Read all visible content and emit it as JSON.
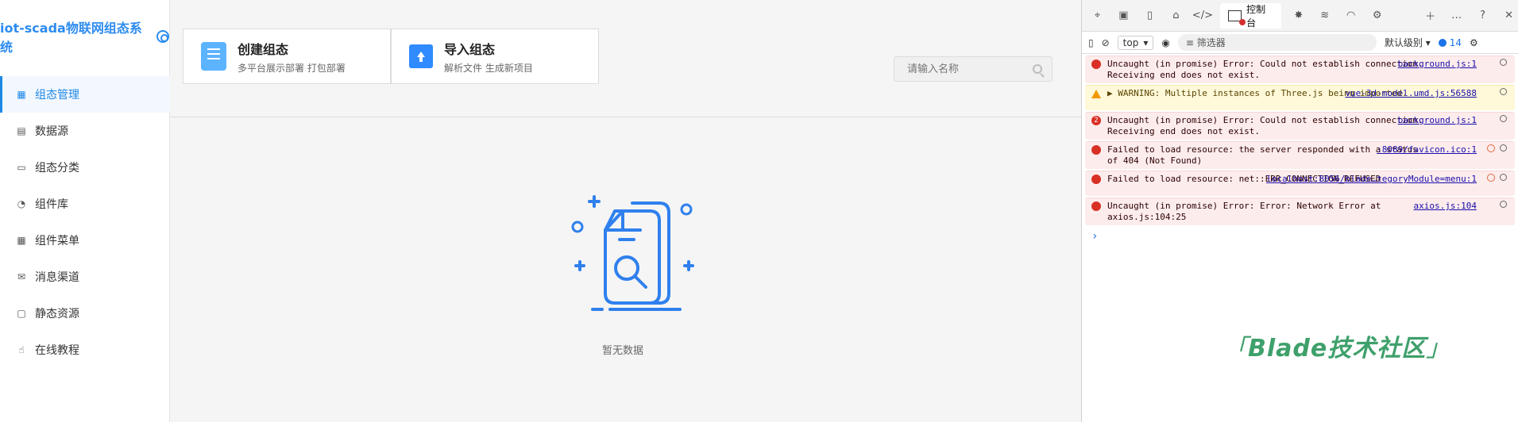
{
  "app": {
    "brand": "iot-scada物联网组态系统",
    "menu": [
      {
        "label": "组态管理",
        "icon": "grid-icon",
        "active": true
      },
      {
        "label": "数据源",
        "icon": "database-icon"
      },
      {
        "label": "组态分类",
        "icon": "folder-icon"
      },
      {
        "label": "组件库",
        "icon": "component-icon"
      },
      {
        "label": "组件菜单",
        "icon": "menu-grid-icon"
      },
      {
        "label": "消息渠道",
        "icon": "mail-icon"
      },
      {
        "label": "静态资源",
        "icon": "archive-icon"
      },
      {
        "label": "在线教程",
        "icon": "hand-icon"
      }
    ],
    "actions": [
      {
        "title": "创建组态",
        "subtitle": "多平台展示部署 打包部署"
      },
      {
        "title": "导入组态",
        "subtitle": "解析文件 生成新项目"
      }
    ],
    "search": {
      "placeholder": "请输入名称"
    },
    "empty": {
      "text": "暂无数据"
    }
  },
  "devtools": {
    "console_tab": "控制台",
    "context": "top",
    "filter_placeholder": "筛选器",
    "level": "默认级别",
    "issue_count": "14",
    "messages": [
      {
        "type": "error",
        "count": "",
        "text": "Uncaught (in promise) Error: Could not establish connection. Receiving end does not exist.",
        "source": "background.js:1"
      },
      {
        "type": "warning",
        "count": "",
        "text": "▶ WARNING: Multiple instances of Three.js being imported.",
        "source": "vue-3d-model.umd.js:56588"
      },
      {
        "type": "error",
        "count": "2",
        "text": "Uncaught (in promise) Error: Could not establish connection. Receiving end does not exist.",
        "source": "background.js:1"
      },
      {
        "type": "error",
        "count": "",
        "text": "Failed to load resource: the server responded with a status of 404 (Not Found)",
        "source": ":8089/favicon.ico:1"
      },
      {
        "type": "error",
        "count": "",
        "text": "Failed to load resource: net::ERR_CONNECTION_REFUSED",
        "source": "localhost:8056/blade…tegoryModule=menu:1"
      },
      {
        "type": "error",
        "count": "",
        "text": "Uncaught (in promise) Error: Error: Network Error at axios.js:104:25",
        "source": "axios.js:104"
      }
    ],
    "prompt": "›"
  },
  "watermark": "Blade技术社区",
  "colors": {
    "accent": "#2d8cf0",
    "error_bg": "#fdecec",
    "warning_bg": "#fff8d9",
    "watermark": "#3ea06b"
  }
}
